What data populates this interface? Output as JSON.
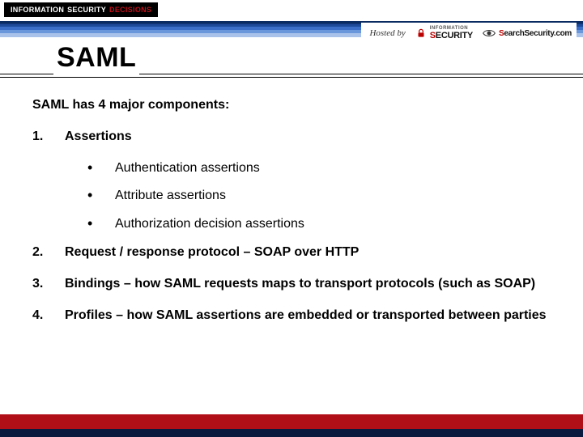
{
  "brand": {
    "word1": "INFORMATION",
    "word2": "SECURITY",
    "word3": "DECISIONS"
  },
  "hosted_by_label": "Hosted by",
  "host1": {
    "pre": "INFORMATION",
    "s": "S",
    "rest": "ECURITY"
  },
  "host2": {
    "s": "S",
    "rest": "earchSecurity",
    "suffix": ".com"
  },
  "title": "SAML",
  "lead": "SAML has 4 major components:",
  "items": [
    {
      "n": "1.",
      "t": "Assertions"
    },
    {
      "n": "2.",
      "t": "Request / response protocol – SOAP over HTTP"
    },
    {
      "n": "3.",
      "t": "Bindings – how SAML requests maps to transport protocols (such as SOAP)"
    },
    {
      "n": "4.",
      "t": "Profiles – how SAML assertions are embedded or transported between parties"
    }
  ],
  "sub": [
    "Authentication assertions",
    "Attribute assertions",
    "Authorization decision assertions"
  ]
}
